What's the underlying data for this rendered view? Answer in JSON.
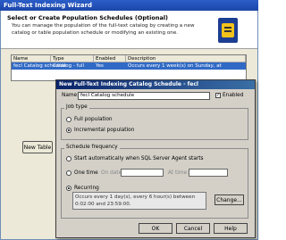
{
  "wizard": {
    "title": "Full-Text Indexing Wizard",
    "heading": "Select or Create Population Schedules (Optional)",
    "description": "You can manage the population of the full-text catalog by creating a new catalog or table population schedule or modifying an existing one.",
    "list": {
      "columns": [
        "Name",
        "Type",
        "Enabled",
        "Description"
      ],
      "rows": [
        {
          "name": "fecl Catalog schedule",
          "type": "Catalog - full",
          "enabled": "Yes",
          "description": "Occurs every 1 week(s) on Sunday, at"
        }
      ]
    },
    "new_table_button": "New Table"
  },
  "dialog": {
    "title": "New Full-Text Indexing Catalog Schedule - fecl",
    "name_label": "Name:",
    "name_value": "fecl Catalog schedule",
    "enabled_label": "Enabled",
    "enabled_checked": true,
    "job_type": {
      "legend": "Job type",
      "options": [
        "Full population",
        "Incremental population"
      ],
      "selected": 1
    },
    "schedule": {
      "legend": "Schedule frequency",
      "start_auto": "Start automatically when SQL Server Agent starts",
      "onetime_label": "One time",
      "onetime_date_label": "On date:",
      "onetime_time_label": "At time:",
      "recurring_label": "Recurring",
      "recurring_desc": "Occurs every 1 day(s), every 6 hour(s) between 0:02:00 and 23:59:00.",
      "change_button": "Change...",
      "selected": "recurring"
    },
    "buttons": {
      "ok": "OK",
      "cancel": "Cancel",
      "help": "Help"
    }
  }
}
